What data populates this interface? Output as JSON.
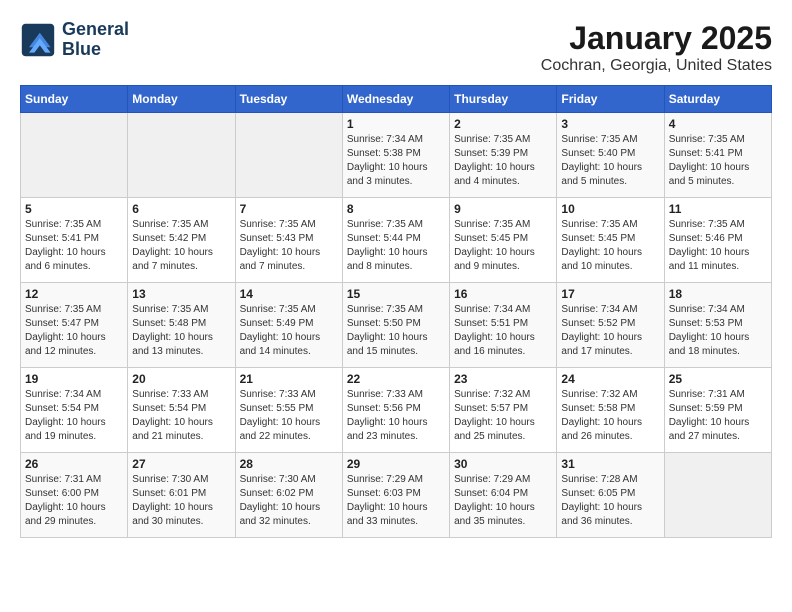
{
  "header": {
    "logo_line1": "General",
    "logo_line2": "Blue",
    "title": "January 2025",
    "subtitle": "Cochran, Georgia, United States"
  },
  "days_of_week": [
    "Sunday",
    "Monday",
    "Tuesday",
    "Wednesday",
    "Thursday",
    "Friday",
    "Saturday"
  ],
  "weeks": [
    [
      {
        "day": "",
        "info": ""
      },
      {
        "day": "",
        "info": ""
      },
      {
        "day": "",
        "info": ""
      },
      {
        "day": "1",
        "info": "Sunrise: 7:34 AM\nSunset: 5:38 PM\nDaylight: 10 hours\nand 3 minutes."
      },
      {
        "day": "2",
        "info": "Sunrise: 7:35 AM\nSunset: 5:39 PM\nDaylight: 10 hours\nand 4 minutes."
      },
      {
        "day": "3",
        "info": "Sunrise: 7:35 AM\nSunset: 5:40 PM\nDaylight: 10 hours\nand 5 minutes."
      },
      {
        "day": "4",
        "info": "Sunrise: 7:35 AM\nSunset: 5:41 PM\nDaylight: 10 hours\nand 5 minutes."
      }
    ],
    [
      {
        "day": "5",
        "info": "Sunrise: 7:35 AM\nSunset: 5:41 PM\nDaylight: 10 hours\nand 6 minutes."
      },
      {
        "day": "6",
        "info": "Sunrise: 7:35 AM\nSunset: 5:42 PM\nDaylight: 10 hours\nand 7 minutes."
      },
      {
        "day": "7",
        "info": "Sunrise: 7:35 AM\nSunset: 5:43 PM\nDaylight: 10 hours\nand 7 minutes."
      },
      {
        "day": "8",
        "info": "Sunrise: 7:35 AM\nSunset: 5:44 PM\nDaylight: 10 hours\nand 8 minutes."
      },
      {
        "day": "9",
        "info": "Sunrise: 7:35 AM\nSunset: 5:45 PM\nDaylight: 10 hours\nand 9 minutes."
      },
      {
        "day": "10",
        "info": "Sunrise: 7:35 AM\nSunset: 5:45 PM\nDaylight: 10 hours\nand 10 minutes."
      },
      {
        "day": "11",
        "info": "Sunrise: 7:35 AM\nSunset: 5:46 PM\nDaylight: 10 hours\nand 11 minutes."
      }
    ],
    [
      {
        "day": "12",
        "info": "Sunrise: 7:35 AM\nSunset: 5:47 PM\nDaylight: 10 hours\nand 12 minutes."
      },
      {
        "day": "13",
        "info": "Sunrise: 7:35 AM\nSunset: 5:48 PM\nDaylight: 10 hours\nand 13 minutes."
      },
      {
        "day": "14",
        "info": "Sunrise: 7:35 AM\nSunset: 5:49 PM\nDaylight: 10 hours\nand 14 minutes."
      },
      {
        "day": "15",
        "info": "Sunrise: 7:35 AM\nSunset: 5:50 PM\nDaylight: 10 hours\nand 15 minutes."
      },
      {
        "day": "16",
        "info": "Sunrise: 7:34 AM\nSunset: 5:51 PM\nDaylight: 10 hours\nand 16 minutes."
      },
      {
        "day": "17",
        "info": "Sunrise: 7:34 AM\nSunset: 5:52 PM\nDaylight: 10 hours\nand 17 minutes."
      },
      {
        "day": "18",
        "info": "Sunrise: 7:34 AM\nSunset: 5:53 PM\nDaylight: 10 hours\nand 18 minutes."
      }
    ],
    [
      {
        "day": "19",
        "info": "Sunrise: 7:34 AM\nSunset: 5:54 PM\nDaylight: 10 hours\nand 19 minutes."
      },
      {
        "day": "20",
        "info": "Sunrise: 7:33 AM\nSunset: 5:54 PM\nDaylight: 10 hours\nand 21 minutes."
      },
      {
        "day": "21",
        "info": "Sunrise: 7:33 AM\nSunset: 5:55 PM\nDaylight: 10 hours\nand 22 minutes."
      },
      {
        "day": "22",
        "info": "Sunrise: 7:33 AM\nSunset: 5:56 PM\nDaylight: 10 hours\nand 23 minutes."
      },
      {
        "day": "23",
        "info": "Sunrise: 7:32 AM\nSunset: 5:57 PM\nDaylight: 10 hours\nand 25 minutes."
      },
      {
        "day": "24",
        "info": "Sunrise: 7:32 AM\nSunset: 5:58 PM\nDaylight: 10 hours\nand 26 minutes."
      },
      {
        "day": "25",
        "info": "Sunrise: 7:31 AM\nSunset: 5:59 PM\nDaylight: 10 hours\nand 27 minutes."
      }
    ],
    [
      {
        "day": "26",
        "info": "Sunrise: 7:31 AM\nSunset: 6:00 PM\nDaylight: 10 hours\nand 29 minutes."
      },
      {
        "day": "27",
        "info": "Sunrise: 7:30 AM\nSunset: 6:01 PM\nDaylight: 10 hours\nand 30 minutes."
      },
      {
        "day": "28",
        "info": "Sunrise: 7:30 AM\nSunset: 6:02 PM\nDaylight: 10 hours\nand 32 minutes."
      },
      {
        "day": "29",
        "info": "Sunrise: 7:29 AM\nSunset: 6:03 PM\nDaylight: 10 hours\nand 33 minutes."
      },
      {
        "day": "30",
        "info": "Sunrise: 7:29 AM\nSunset: 6:04 PM\nDaylight: 10 hours\nand 35 minutes."
      },
      {
        "day": "31",
        "info": "Sunrise: 7:28 AM\nSunset: 6:05 PM\nDaylight: 10 hours\nand 36 minutes."
      },
      {
        "day": "",
        "info": ""
      }
    ]
  ]
}
